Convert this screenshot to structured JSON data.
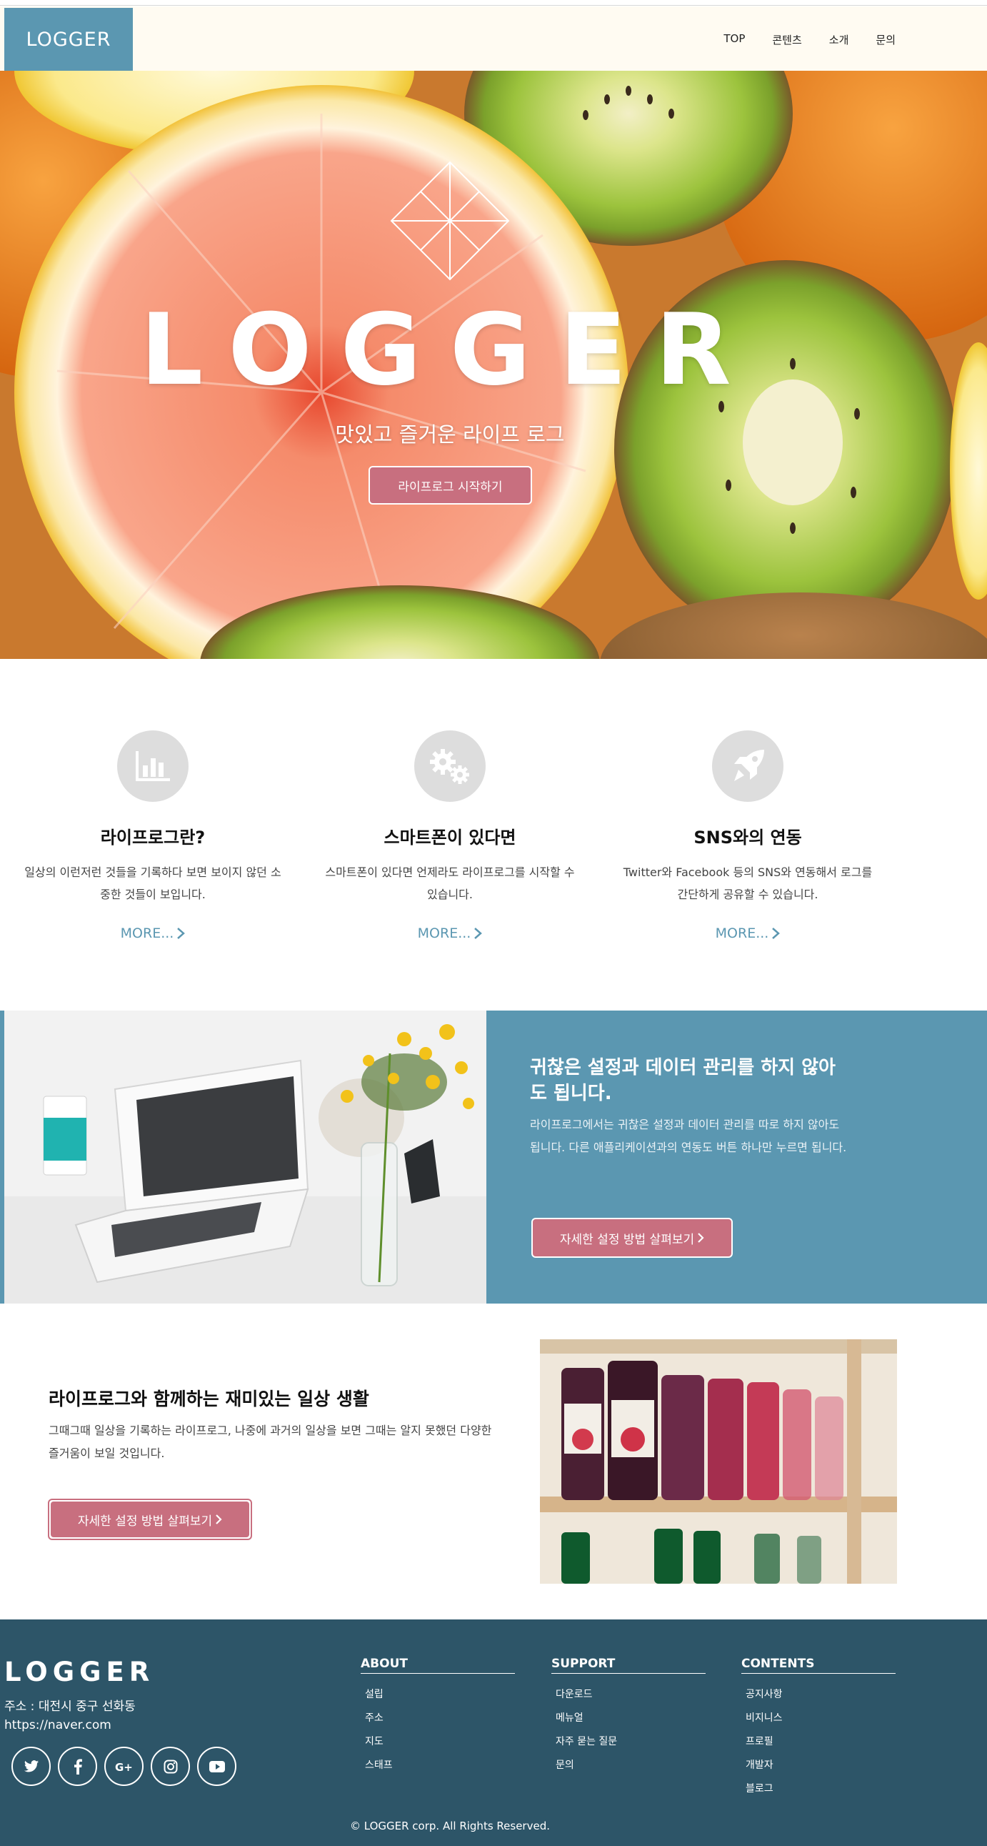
{
  "header": {
    "logo": "LOGGER",
    "nav": [
      "TOP",
      "콘텐츠",
      "소개",
      "문의"
    ]
  },
  "hero": {
    "title": "LOGGER",
    "subtitle": "맛있고 즐거운 라이프 로그",
    "cta": "라이프로그 시작하기"
  },
  "features": [
    {
      "icon": "chart-icon",
      "title": "라이프로그란?",
      "text": "일상의 이런저런 것들을 기록하다 보면 보이지 않던 소중한 것들이 보입니다.",
      "more": "MORE..."
    },
    {
      "icon": "gears-icon",
      "title": "스마트폰이 있다면",
      "text": "스마트폰이 있다면 언제라도 라이프로그를 시작할 수 있습니다.",
      "more": "MORE..."
    },
    {
      "icon": "rocket-icon",
      "title": "SNS와의 연동",
      "text": "Twitter와 Facebook 등의 SNS와 연동해서 로그를 간단하게 공유할 수 있습니다.",
      "more": "MORE..."
    }
  ],
  "settings_section": {
    "title": "귀찮은 설정과 데이터 관리를 하지 않아도 됩니다.",
    "text": "라이프로그에서는 귀찮은 설정과 데이터 관리를 따로 하지 않아도 됩니다. 다른 애플리케이션과의 연동도 버튼 하나만 누르면 됩니다.",
    "button": "자세한 설정 방법 살펴보기"
  },
  "daily_section": {
    "title": "라이프로그와 함께하는 재미있는 일상 생활",
    "text": "그때그때 일상을 기록하는 라이프로그, 나중에 과거의 일상을 보면 그때는 알지 못했던 다양한 즐거움이 보일 것입니다.",
    "button": "자세한 설정 방법 살펴보기"
  },
  "footer": {
    "logo": "LOGGER",
    "address": "주소 : 대전시 중구 선화동",
    "url": "https://naver.com",
    "socials": [
      "twitter-icon",
      "facebook-icon",
      "google-plus-icon",
      "instagram-icon",
      "youtube-icon"
    ],
    "columns": [
      {
        "title": "ABOUT",
        "items": [
          "설립",
          "주소",
          "지도",
          "스태프"
        ]
      },
      {
        "title": "SUPPORT",
        "items": [
          "다운로드",
          "메뉴얼",
          "자주 묻는 질문",
          "문의"
        ]
      },
      {
        "title": "CONTENTS",
        "items": [
          "공지사항",
          "비지니스",
          "프로필",
          "개발자",
          "블로그"
        ]
      }
    ],
    "copyright": "© LOGGER corp. All Rights Reserved."
  },
  "colors": {
    "accent_blue": "#5b97b1",
    "button_pink": "#c86f7f",
    "footer_bg": "#2d5568"
  }
}
